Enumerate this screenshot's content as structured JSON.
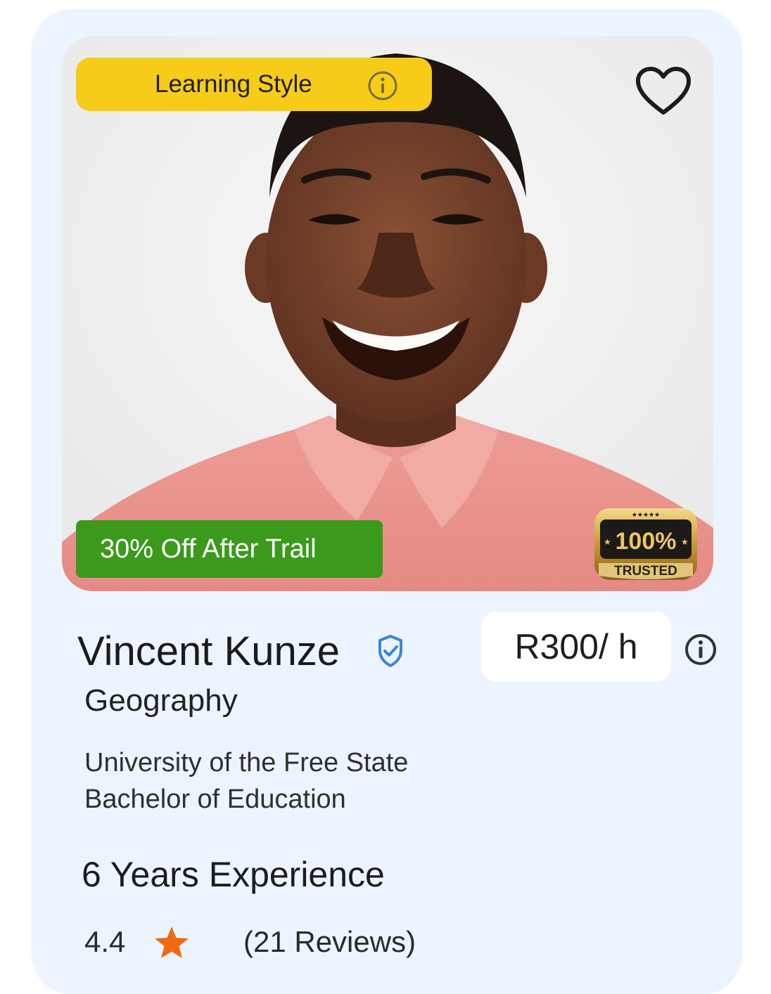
{
  "card": {
    "learning_style_label": "Learning Style",
    "discount_label": "30% Off After Trail",
    "trusted_badge": {
      "percent": "100%",
      "label": "TRUSTED",
      "stars": "★★★★★"
    },
    "tutor": {
      "name": "Vincent Kunze",
      "subject": "Geography",
      "university": "University of the Free State",
      "degree": "Bachelor of Education",
      "experience": "6 Years Experience",
      "rating": "4.4",
      "reviews": "(21 Reviews)"
    },
    "price": "R300/ h"
  },
  "colors": {
    "card_bg": "#ecf5fd",
    "learning_style_bg": "#f7cc19",
    "discount_bg": "#3b9a1c",
    "star": "#f06a0f",
    "verified": "#3a86d6"
  },
  "icons": {
    "favorite": "heart-outline-icon",
    "info": "info-circle-icon",
    "verified": "verified-shield-icon",
    "rating": "star-icon"
  }
}
